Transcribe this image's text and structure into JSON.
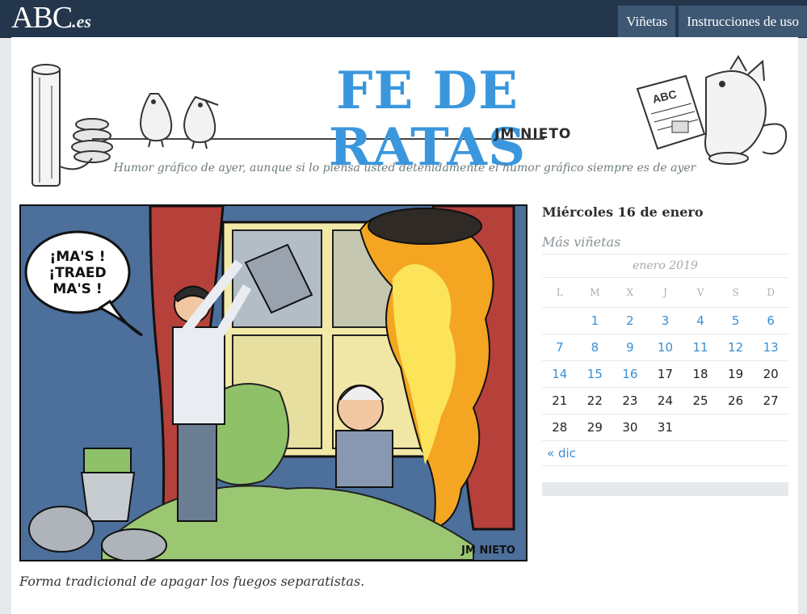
{
  "header": {
    "logo_main": "ABC",
    "logo_suffix": ".es",
    "nav": [
      {
        "label": "Viñetas"
      },
      {
        "label": "Instrucciones de uso"
      }
    ]
  },
  "banner": {
    "title": "FE DE RATAS",
    "author": "JM NIETO",
    "tagline": "Humor gráfico de ayer, aunque si lo piensa usted detenidamente el humor gráfico siempre es de ayer",
    "newspaper_text": "ABC"
  },
  "cartoon": {
    "speech": [
      "¡MA'S !",
      "¡TRAED",
      "MA'S !"
    ],
    "signature": "JM NIETO",
    "caption": "Forma tradicional de apagar los fuegos separatistas."
  },
  "sidebar": {
    "date_heading": "Miércoles 16 de enero",
    "more_heading": "Más viñetas",
    "calendar": {
      "month": "enero 2019",
      "weekdays": [
        "L",
        "M",
        "X",
        "J",
        "V",
        "S",
        "D"
      ],
      "rows": [
        [
          {
            "t": ""
          },
          {
            "t": "1",
            "l": true
          },
          {
            "t": "2",
            "l": true
          },
          {
            "t": "3",
            "l": true
          },
          {
            "t": "4",
            "l": true
          },
          {
            "t": "5",
            "l": true
          },
          {
            "t": "6",
            "l": true
          }
        ],
        [
          {
            "t": "7",
            "l": true
          },
          {
            "t": "8",
            "l": true
          },
          {
            "t": "9",
            "l": true
          },
          {
            "t": "10",
            "l": true
          },
          {
            "t": "11",
            "l": true
          },
          {
            "t": "12",
            "l": true
          },
          {
            "t": "13",
            "l": true
          }
        ],
        [
          {
            "t": "14",
            "l": true
          },
          {
            "t": "15",
            "l": true
          },
          {
            "t": "16",
            "l": true
          },
          {
            "t": "17"
          },
          {
            "t": "18"
          },
          {
            "t": "19"
          },
          {
            "t": "20"
          }
        ],
        [
          {
            "t": "21"
          },
          {
            "t": "22"
          },
          {
            "t": "23"
          },
          {
            "t": "24"
          },
          {
            "t": "25"
          },
          {
            "t": "26"
          },
          {
            "t": "27"
          }
        ],
        [
          {
            "t": "28"
          },
          {
            "t": "29"
          },
          {
            "t": "30"
          },
          {
            "t": "31"
          },
          {
            "t": ""
          },
          {
            "t": ""
          },
          {
            "t": ""
          }
        ]
      ],
      "prev_label": "« dic"
    }
  },
  "colors": {
    "title_blue": "#3a97de",
    "topbar": "#24364b",
    "nav_button": "#3e5874",
    "link": "#3a8fd4"
  }
}
